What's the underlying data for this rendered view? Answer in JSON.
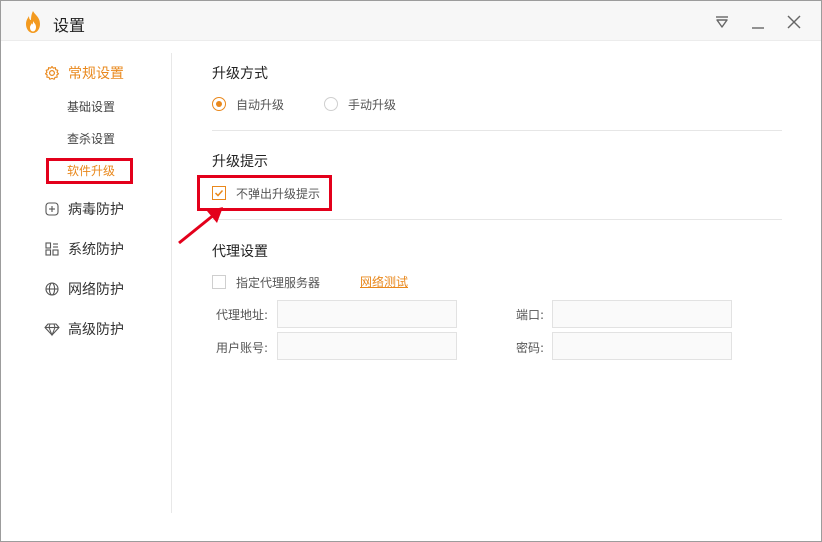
{
  "window": {
    "title": "设置",
    "controls": [
      "menu",
      "minimize",
      "close"
    ]
  },
  "colors": {
    "accent": "#e9881c",
    "annotation": "#e3001b"
  },
  "sidebar": {
    "groups": [
      {
        "label": "常规设置",
        "icon": "gear-icon",
        "active": true,
        "items": [
          {
            "label": "基础设置",
            "active": false
          },
          {
            "label": "查杀设置",
            "active": false
          },
          {
            "label": "软件升级",
            "active": true
          }
        ]
      },
      {
        "label": "病毒防护",
        "icon": "plus-square-icon",
        "active": false
      },
      {
        "label": "系统防护",
        "icon": "grid-icon",
        "active": false
      },
      {
        "label": "网络防护",
        "icon": "globe-icon",
        "active": false
      },
      {
        "label": "高级防护",
        "icon": "diamond-icon",
        "active": false
      }
    ]
  },
  "upgrade_mode": {
    "title": "升级方式",
    "options": [
      {
        "label": "自动升级",
        "selected": true
      },
      {
        "label": "手动升级",
        "selected": false
      }
    ]
  },
  "upgrade_prompt": {
    "title": "升级提示",
    "checkbox_label": "不弹出升级提示",
    "checked": true
  },
  "proxy": {
    "title": "代理设置",
    "enable_label": "指定代理服务器",
    "enabled": false,
    "test_link": "网络测试",
    "fields": {
      "address_label": "代理地址:",
      "port_label": "端口:",
      "user_label": "用户账号:",
      "password_label": "密码:"
    },
    "values": {
      "address": "",
      "port": "",
      "user": "",
      "password": ""
    }
  }
}
